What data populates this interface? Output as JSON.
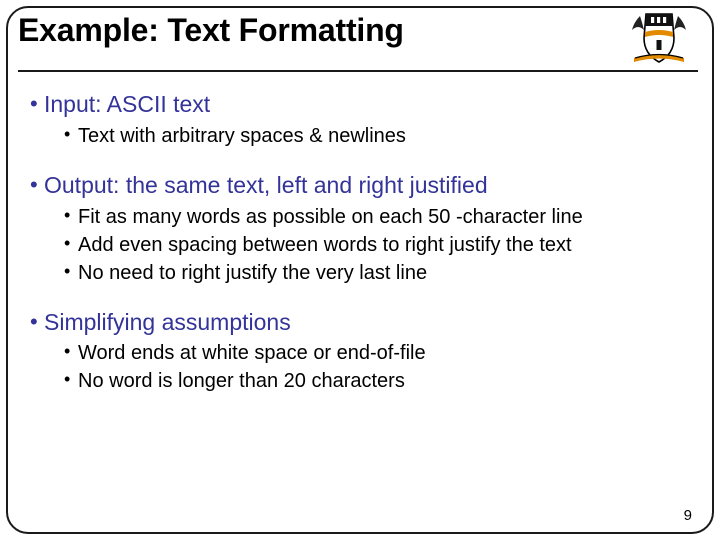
{
  "title": "Example: Text Formatting",
  "bullets": {
    "b1": "Input: ASCII text",
    "b1_1": "Text with arbitrary spaces & newlines",
    "b2": "Output: the same text, left and right justified",
    "b2_1": "Fit as many words as possible on each 50 -character line",
    "b2_2": "Add even spacing between words to right justify the text",
    "b2_3": "No need to right justify the very last line",
    "b3": "Simplifying assumptions",
    "b3_1": "Word ends at white space or end-of-file",
    "b3_2": "No word is longer than 20 characters"
  },
  "page_number": "9",
  "logo": {
    "name": "princeton-shield-icon"
  }
}
